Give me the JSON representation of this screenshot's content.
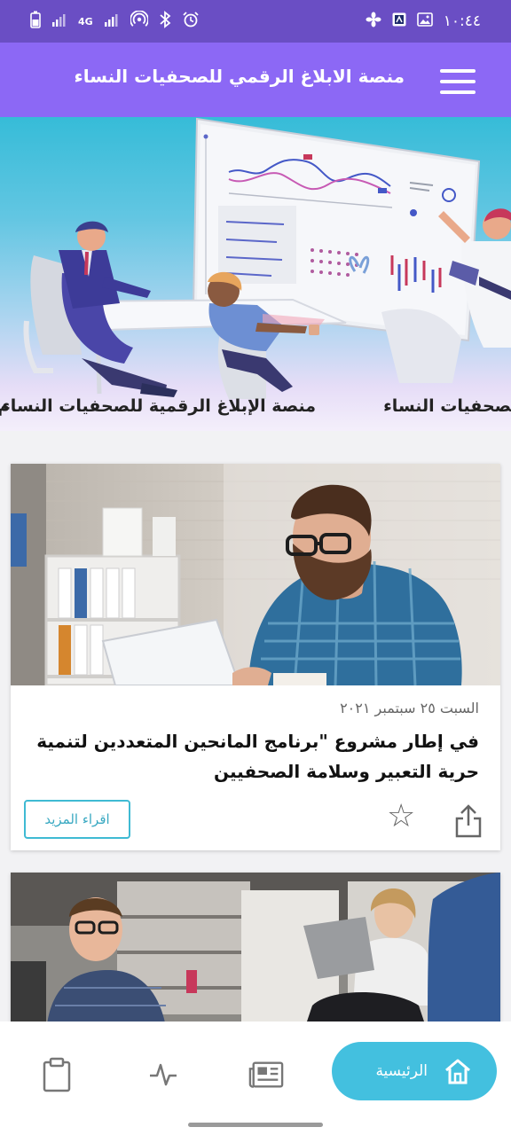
{
  "status_bar": {
    "time": "١٠:٤٤",
    "network": "4G",
    "icons": [
      "battery-icon",
      "signal-icon",
      "signal-icon",
      "hotspot-icon",
      "bluetooth-icon",
      "alarm-icon",
      "image-icon",
      "app-notification-icon",
      "fan-icon"
    ]
  },
  "header": {
    "title": "منصة الابلاغ الرقمي للصحفيات النساء",
    "menu_icon": "hamburger-menu-icon"
  },
  "banner": {
    "ticker_text": "منصة الإبلاغ الرقمية للصحفيات النساء",
    "ticker_partial": "م"
  },
  "articles": [
    {
      "date": "السبت ٢٥ سبتمبر ٢٠٢١",
      "title": "في إطار مشروع \"برنامج المانحين المتعددين لتنمية حرية التعبير وسلامة الصحفيين",
      "read_more": "اقراء المزيد"
    }
  ],
  "bottom_nav": {
    "home_label": "الرئيسية",
    "items": [
      "clipboard-icon",
      "activity-icon",
      "newspaper-icon",
      "home-icon"
    ]
  },
  "colors": {
    "status_bar": "#6a4ec4",
    "header": "#8c68f5",
    "accent": "#43c0df"
  }
}
